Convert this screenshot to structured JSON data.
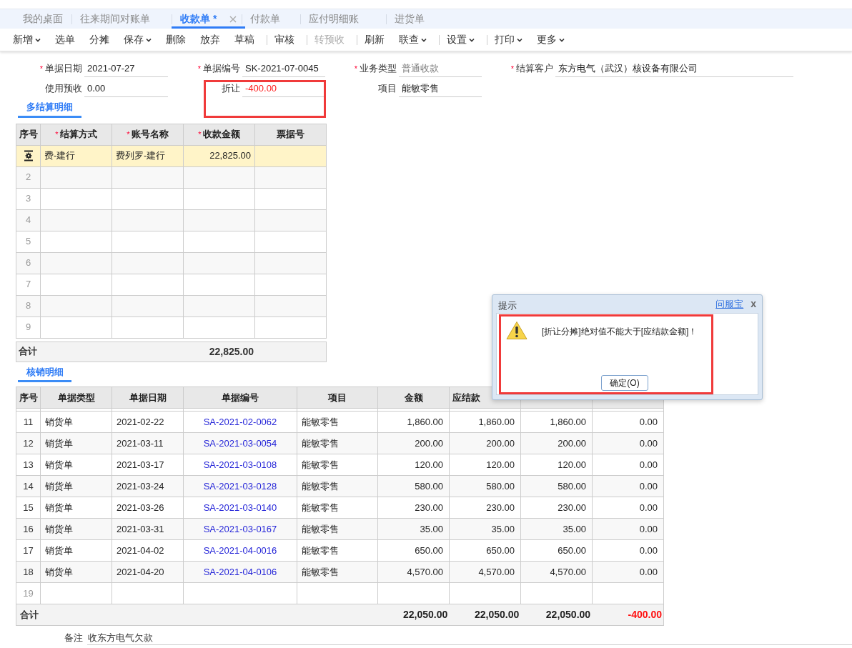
{
  "tabs": [
    {
      "label": "我的桌面",
      "selected": false,
      "closable": false
    },
    {
      "label": "往来期间对账单",
      "selected": false,
      "closable": false
    },
    {
      "label": "收款单 *",
      "selected": true,
      "closable": true
    },
    {
      "label": "付款单",
      "selected": false,
      "closable": false
    },
    {
      "label": "应付明细账",
      "selected": false,
      "closable": false
    },
    {
      "label": "进货单",
      "selected": false,
      "closable": false
    }
  ],
  "toolbar": [
    {
      "label": "新增",
      "dropdown": true,
      "disabled": false,
      "separator_before": false
    },
    {
      "label": "选单",
      "dropdown": false,
      "disabled": false,
      "separator_before": false
    },
    {
      "label": "分摊",
      "dropdown": false,
      "disabled": false,
      "separator_before": false
    },
    {
      "label": "保存",
      "dropdown": true,
      "disabled": false,
      "separator_before": false
    },
    {
      "label": "删除",
      "dropdown": false,
      "disabled": false,
      "separator_before": false
    },
    {
      "label": "放弃",
      "dropdown": false,
      "disabled": false,
      "separator_before": false
    },
    {
      "label": "草稿",
      "dropdown": false,
      "disabled": false,
      "separator_before": false
    },
    {
      "label": "审核",
      "dropdown": false,
      "disabled": false,
      "separator_before": true
    },
    {
      "label": "转预收",
      "dropdown": false,
      "disabled": true,
      "separator_before": true
    },
    {
      "label": "刷新",
      "dropdown": false,
      "disabled": false,
      "separator_before": true
    },
    {
      "label": "联查",
      "dropdown": true,
      "disabled": false,
      "separator_before": false
    },
    {
      "label": "设置",
      "dropdown": true,
      "disabled": false,
      "separator_before": true
    },
    {
      "label": "打印",
      "dropdown": true,
      "disabled": false,
      "separator_before": true
    },
    {
      "label": "更多",
      "dropdown": true,
      "disabled": false,
      "separator_before": false
    }
  ],
  "form": [
    [
      {
        "mark": "*",
        "label": "单据日期",
        "value": "2021-07-27",
        "negative": false,
        "disabled": false,
        "highlighted": false
      },
      {
        "mark": "*",
        "label": "单据编号",
        "value": "SK-2021-07-0045",
        "negative": false,
        "disabled": false,
        "highlighted": false
      },
      {
        "mark": "*",
        "label": "业务类型",
        "value": "普通收款",
        "negative": false,
        "disabled": true,
        "highlighted": false
      },
      {
        "mark": "*",
        "label": "结算客户",
        "value": "东方电气（武汉）核设备有限公司",
        "negative": false,
        "disabled": false,
        "highlighted": false
      }
    ],
    [
      {
        "label": "使用预收",
        "value": "0.00",
        "negative": false,
        "disabled": false,
        "highlighted": false
      },
      {
        "label": "折让",
        "value": "-400.00",
        "negative": true,
        "disabled": false,
        "highlighted": true
      },
      {
        "label": "项目",
        "value": "能敏零售",
        "negative": false,
        "disabled": false,
        "highlighted": false
      }
    ]
  ],
  "settlement": {
    "title": "多结算明细",
    "columns": [
      {
        "label": "序号"
      },
      {
        "mark": "*",
        "label": "结算方式"
      },
      {
        "mark": "*",
        "label": "账号名称"
      },
      {
        "mark": "*",
        "label": "收款金额"
      },
      {
        "label": "票据号"
      }
    ],
    "rows": [
      {
        "selected": true,
        "cells": [
          "",
          "费-建行",
          "费列罗-建行",
          "22,825.00",
          ""
        ]
      },
      {
        "selected": false,
        "cells": [
          "2",
          "",
          "",
          "",
          ""
        ]
      },
      {
        "selected": false,
        "cells": [
          "3",
          "",
          "",
          "",
          ""
        ]
      },
      {
        "selected": false,
        "cells": [
          "4",
          "",
          "",
          "",
          ""
        ]
      },
      {
        "selected": false,
        "cells": [
          "5",
          "",
          "",
          "",
          ""
        ]
      },
      {
        "selected": false,
        "cells": [
          "6",
          "",
          "",
          "",
          ""
        ]
      },
      {
        "selected": false,
        "cells": [
          "7",
          "",
          "",
          "",
          ""
        ]
      },
      {
        "selected": false,
        "cells": [
          "8",
          "",
          "",
          "",
          ""
        ]
      },
      {
        "selected": false,
        "cells": [
          "9",
          "",
          "",
          "",
          ""
        ]
      }
    ],
    "total_label": "合计",
    "total_amount": "22,825.00"
  },
  "writeoff": {
    "title": "核销明细",
    "columns": [
      "序号",
      "单据类型",
      "单据日期",
      "单据编号",
      "项目",
      "金额",
      "应结款"
    ],
    "rows": [
      [
        "11",
        "销货单",
        "2021-02-22",
        "SA-2021-02-0062",
        "能敏零售",
        "1,860.00",
        "1,860.00",
        "1,860.00",
        "0.00"
      ],
      [
        "12",
        "销货单",
        "2021-03-11",
        "SA-2021-03-0054",
        "能敏零售",
        "200.00",
        "200.00",
        "200.00",
        "0.00"
      ],
      [
        "13",
        "销货单",
        "2021-03-17",
        "SA-2021-03-0108",
        "能敏零售",
        "120.00",
        "120.00",
        "120.00",
        "0.00"
      ],
      [
        "14",
        "销货单",
        "2021-03-24",
        "SA-2021-03-0128",
        "能敏零售",
        "580.00",
        "580.00",
        "580.00",
        "0.00"
      ],
      [
        "15",
        "销货单",
        "2021-03-26",
        "SA-2021-03-0140",
        "能敏零售",
        "230.00",
        "230.00",
        "230.00",
        "0.00"
      ],
      [
        "16",
        "销货单",
        "2021-03-31",
        "SA-2021-03-0167",
        "能敏零售",
        "35.00",
        "35.00",
        "35.00",
        "0.00"
      ],
      [
        "17",
        "销货单",
        "2021-04-02",
        "SA-2021-04-0016",
        "能敏零售",
        "650.00",
        "650.00",
        "650.00",
        "0.00"
      ],
      [
        "18",
        "销货单",
        "2021-04-20",
        "SA-2021-04-0106",
        "能敏零售",
        "4,570.00",
        "4,570.00",
        "4,570.00",
        "0.00"
      ],
      [
        "19",
        "",
        "",
        "",
        "",
        "",
        "",
        "",
        ""
      ]
    ],
    "total_label": "合计",
    "totals": [
      "22,050.00",
      "22,050.00",
      "22,050.00",
      "-400.00"
    ]
  },
  "note": {
    "label": "备注",
    "value": "收东方电气欠款"
  },
  "dialog": {
    "title": "提示",
    "help_link": "问服宝",
    "close": "x",
    "message": "[折让分摊]绝对值不能大于[应结款金额]！",
    "button": "确定(O)",
    "highlighted": true
  }
}
